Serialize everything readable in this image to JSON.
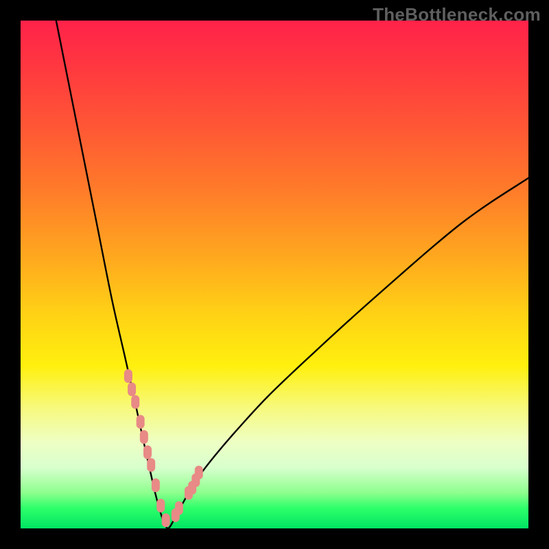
{
  "watermark": "TheBottleneck.com",
  "colors": {
    "background": "#000000",
    "curve": "#000000",
    "marker_fill": "#e88a86",
    "marker_stroke": "#d46b66"
  },
  "chart_data": {
    "type": "line",
    "title": "",
    "xlabel": "",
    "ylabel": "",
    "xlim": [
      0,
      100
    ],
    "ylim": [
      0,
      100
    ],
    "note": "V-shaped bottleneck curve; minimum at optimal match. Axes unlabeled; values estimated from pixel positions in a 740×740 plot area (x,y as percent of range, y=0 at bottom).",
    "series": [
      {
        "name": "bottleneck-curve",
        "type": "line",
        "x": [
          7.0,
          11.0,
          15.0,
          18.0,
          20.5,
          22.3,
          23.7,
          24.8,
          25.7,
          26.5,
          27.3,
          28.1,
          29.0,
          30.1,
          31.4,
          33.1,
          35.3,
          38.4,
          42.7,
          48.7,
          57.1,
          69.2,
          86.7,
          100.0
        ],
        "y": [
          100.0,
          80.0,
          60.0,
          45.0,
          34.0,
          26.0,
          19.5,
          14.5,
          10.5,
          7.0,
          4.0,
          1.5,
          0.0,
          1.5,
          4.0,
          7.0,
          10.5,
          14.5,
          19.5,
          26.0,
          34.0,
          45.0,
          60.0,
          69.0
        ]
      },
      {
        "name": "markers",
        "type": "scatter",
        "x": [
          21.2,
          21.9,
          22.6,
          23.6,
          24.3,
          25.0,
          25.7,
          26.6,
          27.6,
          28.6,
          30.5,
          31.2,
          33.1,
          33.8,
          34.5,
          35.1
        ],
        "y": [
          30.0,
          27.4,
          24.9,
          21.0,
          18.0,
          15.0,
          12.5,
          8.5,
          4.5,
          1.6,
          2.6,
          4.0,
          7.0,
          8.0,
          9.5,
          11.0
        ]
      }
    ]
  }
}
